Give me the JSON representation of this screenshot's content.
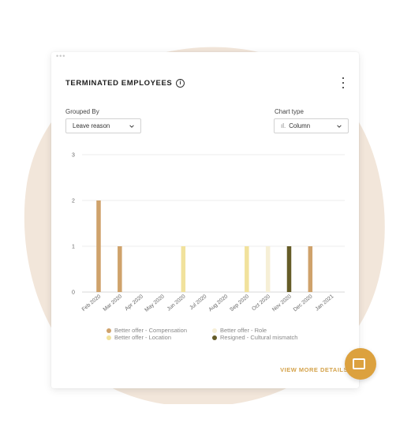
{
  "card": {
    "menu_dots": "•••",
    "title": "TERMINATED EMPLOYEES",
    "info_glyph": "i",
    "view_more_label": "VIEW MORE DETAILS"
  },
  "controls": {
    "grouped_by_label": "Grouped By",
    "grouped_by_value": "Leave reason",
    "chart_type_label": "Chart type",
    "chart_type_icon_glyph": "ıl.",
    "chart_type_value": "Column"
  },
  "colors": {
    "compensation": "#cfa26b",
    "location": "#f1e29c",
    "role": "#f6efd6",
    "cultural": "#655c27",
    "blob": "#f2e6da",
    "accent": "#dca13e"
  },
  "chart_data": {
    "type": "bar",
    "categories": [
      "Feb 2020",
      "Mar 2020",
      "Apr 2020",
      "May 2020",
      "Jun 2020",
      "Jul 2020",
      "Aug 2020",
      "Sep 2020",
      "Oct 2020",
      "Nov 2020",
      "Dec 2020",
      "Jan 2021"
    ],
    "series": [
      {
        "name": "Better offer - Compensation",
        "color": "#cfa26b",
        "values": [
          2,
          1,
          0,
          0,
          0,
          0,
          0,
          0,
          0,
          0,
          1,
          0
        ]
      },
      {
        "name": "Better offer - Location",
        "color": "#f1e29c",
        "values": [
          0,
          0,
          0,
          0,
          1,
          0,
          0,
          1,
          0,
          0,
          0,
          0
        ]
      },
      {
        "name": "Better offer - Role",
        "color": "#f6efd6",
        "values": [
          0,
          0,
          0,
          0,
          0,
          0,
          0,
          0,
          1,
          0,
          0,
          0
        ]
      },
      {
        "name": "Resigned - Cultural mismatch",
        "color": "#655c27",
        "values": [
          0,
          0,
          0,
          0,
          0,
          0,
          0,
          0,
          0,
          1,
          0,
          0
        ]
      }
    ],
    "ylim": [
      0,
      3
    ],
    "yticks": [
      0,
      1,
      2,
      3
    ],
    "grid": true,
    "legend_position": "bottom"
  }
}
